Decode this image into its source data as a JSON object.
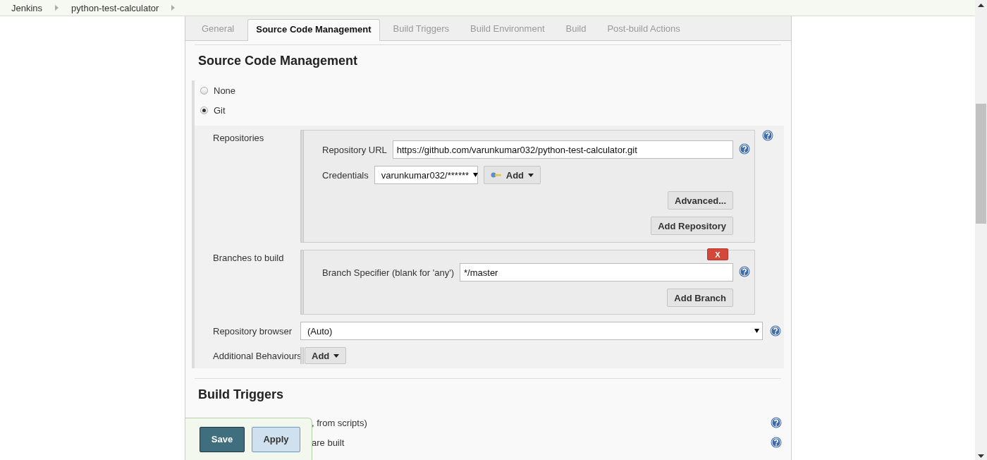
{
  "breadcrumbs": [
    {
      "label": "Jenkins"
    },
    {
      "label": "python-test-calculator"
    }
  ],
  "tabs": [
    {
      "label": "General",
      "selected": false
    },
    {
      "label": "Source Code Management",
      "selected": true
    },
    {
      "label": "Build Triggers",
      "selected": false
    },
    {
      "label": "Build Environment",
      "selected": false
    },
    {
      "label": "Build",
      "selected": false
    },
    {
      "label": "Post-build Actions",
      "selected": false
    }
  ],
  "scm": {
    "title": "Source Code Management",
    "options": [
      {
        "label": "None",
        "selected": false
      },
      {
        "label": "Git",
        "selected": true
      }
    ],
    "repositories": {
      "label": "Repositories",
      "url_label": "Repository URL",
      "url_value": "https://github.com/varunkumar032/python-test-calculator.git",
      "credentials_label": "Credentials",
      "credentials_value": "varunkumar032/******",
      "add_button": "Add",
      "advanced_button": "Advanced...",
      "add_repository_button": "Add Repository"
    },
    "branches": {
      "label": "Branches to build",
      "delete_button": "X",
      "specifier_label": "Branch Specifier (blank for 'any')",
      "specifier_value": "*/master",
      "add_button": "Add Branch"
    },
    "repository_browser": {
      "label": "Repository browser",
      "value": "(Auto)"
    },
    "additional_behaviours": {
      "label": "Additional Behaviours",
      "add_button": "Add"
    }
  },
  "build_triggers": {
    "title": "Build Triggers",
    "options": [
      {
        "label": ", from scripts)",
        "obscured": true
      },
      {
        "label": "are built",
        "obscured": true
      }
    ]
  },
  "actions": [
    {
      "label": "Save",
      "kind": "primary"
    },
    {
      "label": "Apply",
      "kind": "secondary"
    }
  ]
}
